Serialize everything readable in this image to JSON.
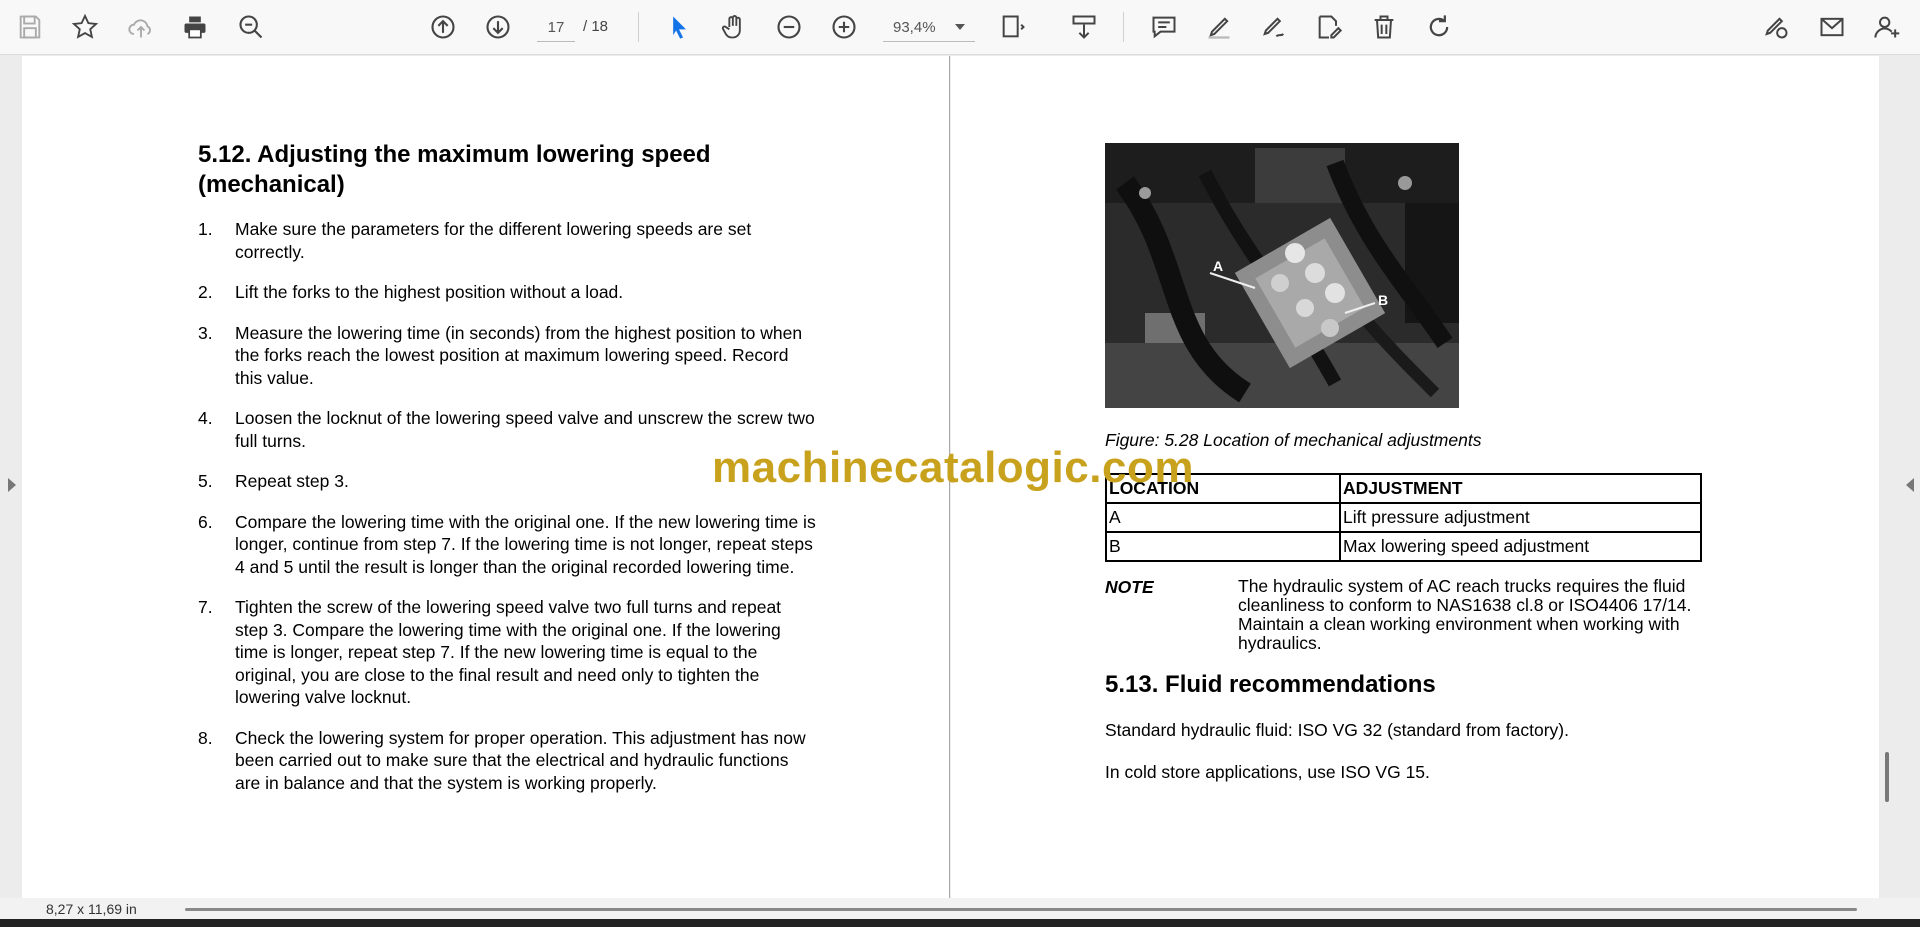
{
  "toolbar": {
    "icons": [
      "save-icon",
      "bookmark-star-icon",
      "cloud-upload-icon",
      "print-icon",
      "zoom-search-icon",
      "page-up-icon",
      "page-down-icon",
      "select-arrow-icon",
      "hand-tool-icon",
      "zoom-out-icon",
      "zoom-in-icon",
      "fit-page-icon",
      "download-icon",
      "comment-icon",
      "highlight-pen-icon",
      "sign-icon",
      "edit-share-icon",
      "delete-icon",
      "rotate-icon",
      "share-link-icon",
      "mail-icon",
      "add-user-icon"
    ],
    "current_page": "17",
    "total_pages": "/ 18",
    "zoom": "93,4%"
  },
  "left_page": {
    "title": "5.12. Adjusting the maximum lowering speed (mechanical)",
    "steps": [
      {
        "num": "1.",
        "text": "Make sure the parameters for the different lowering speeds are set correctly."
      },
      {
        "num": "2.",
        "text": "Lift the forks to the highest position without a load."
      },
      {
        "num": "3.",
        "text": "Measure the lowering time (in seconds) from the highest position to when the forks reach the lowest position at maximum lowering speed. Record this value."
      },
      {
        "num": "4.",
        "text": "Loosen the locknut of the lowering speed valve and unscrew the screw two full turns."
      },
      {
        "num": "5.",
        "text": "Repeat step 3."
      },
      {
        "num": "6.",
        "text": "Compare the lowering time with the original one. If the new lowering time is longer, continue from step 7. If the lowering time is not longer, repeat steps 4 and 5 until the result is longer than the original recorded lowering time."
      },
      {
        "num": "7.",
        "text": "Tighten the screw of the lowering speed valve two full turns and repeat step 3. Compare the lowering time with the original one. If the lowering time is longer, repeat step 7. If the new lowering time is equal to the original, you are close to the final result and need only to tighten the lowering valve locknut."
      },
      {
        "num": "8.",
        "text": "Check the lowering system for proper operation. This adjustment has now been carried out to make sure that the electrical and hydraulic functions are in balance and that the system is working properly."
      }
    ]
  },
  "right_page": {
    "photo_labels": {
      "a": "A",
      "b": "B"
    },
    "figure_caption": "Figure: 5.28 Location of mechanical adjustments",
    "table": {
      "headers": [
        "LOCATION",
        "ADJUSTMENT"
      ],
      "rows": [
        [
          "A",
          "Lift pressure adjustment"
        ],
        [
          "B",
          "Max lowering speed adjustment"
        ]
      ]
    },
    "note_label": "NOTE",
    "note_text": "The hydraulic system of AC reach trucks requires the fluid cleanliness to conform to NAS1638 cl.8 or ISO4406 17/14. Maintain a clean working environment when working with hydraulics.",
    "section_title": "5.13. Fluid recommendations",
    "para1": "Standard hydraulic fluid: ISO VG 32 (standard from factory).",
    "para2": "In cold store applications, use ISO VG 15."
  },
  "watermark": "machinecatalogic.com",
  "status": {
    "page_size": "8,27 x 11,69 in"
  },
  "colors": {
    "select_tool": "#1473e6",
    "watermark": "#c9a21d"
  }
}
